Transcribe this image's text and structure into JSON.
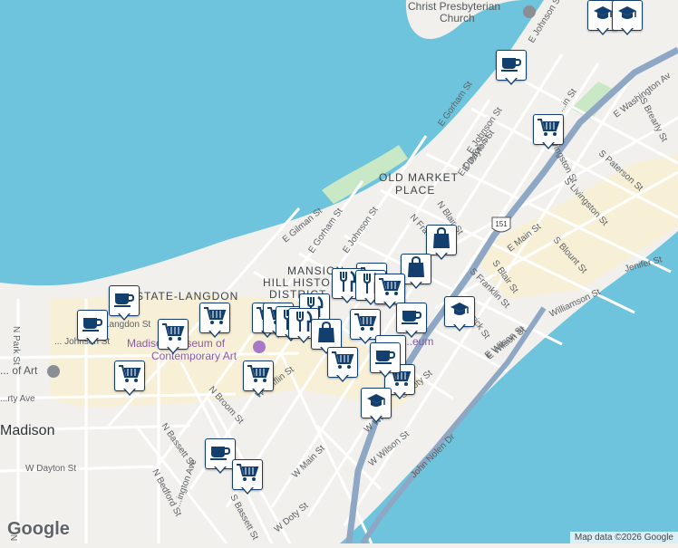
{
  "map": {
    "colors": {
      "water": "#6ec4dc",
      "land": "#f1f0ed",
      "park": "#c9e8c5",
      "highway": "#8ea7c4",
      "major_road": "#ffffff",
      "minor_road": "#ffffff",
      "highlight_area": "#f7eed3",
      "marker_border": "#123f6d",
      "marker_icon": "#123f6d"
    },
    "labels": {
      "church": "Christ Presbyterian\nChurch",
      "old_market": "OLD MARKET\nPLACE",
      "mansion_hill": "MANSION\nHILL HISTO\nDISTRICT",
      "state_langdon": "STATE-LANGDON",
      "museum": "Madison Museum of\nContemporary Art",
      "history_museum": "...eum",
      "art": "... of Art",
      "madison": "Madison",
      "highway_shield": "151"
    },
    "streets": [
      "E Johnson St",
      "E Gorham St",
      "E Johnson St",
      "N Livingston St",
      "E Dayton St",
      "E Washington Av",
      "S Brearly St",
      "S Paterson St",
      "S Livingston St",
      "E Main St",
      "S Blount St",
      "Jenifer St",
      "E Gilman St",
      "E Gorham St",
      "N Blair St",
      "S Blair St",
      "S Franklin St",
      "Williamson St",
      "E Wilson St",
      "E Johnson St",
      "N Fra",
      "Langdon St",
      "N Park St",
      "N Park St",
      "... Johnson St",
      "N Broom St",
      "W Mifflin St",
      "N Bassett St",
      "W Dayton St",
      "N Bedford St",
      "W Main St",
      "S Bassett St",
      "...ington Ave",
      "W Doty St",
      "W Wilson St",
      "John Nolen Dr",
      "W Wi...",
      "S Doty St",
      "...rty Ave",
      "E Dayton St",
      "...in St",
      "...rick St",
      "E Wilson St"
    ],
    "markers": [
      {
        "icon": "school-icon"
      },
      {
        "icon": "school-icon"
      },
      {
        "icon": "coffee-icon"
      },
      {
        "icon": "shopping-cart-icon"
      },
      {
        "icon": "shopping-bag-icon"
      },
      {
        "icon": "shopping-bag-icon"
      },
      {
        "icon": "shopping-cart-icon"
      },
      {
        "icon": "shopping-cart-icon"
      },
      {
        "icon": "restaurant-icon"
      },
      {
        "icon": "restaurant-icon"
      },
      {
        "icon": "shopping-cart-icon"
      },
      {
        "icon": "coffee-icon"
      },
      {
        "icon": "school-icon"
      },
      {
        "icon": "coffee-icon"
      },
      {
        "icon": "coffee-icon"
      },
      {
        "icon": "shopping-cart-icon"
      },
      {
        "icon": "shopping-cart-icon"
      },
      {
        "icon": "shopping-cart-icon"
      },
      {
        "icon": "shopping-cart-icon"
      },
      {
        "icon": "restaurant-icon"
      },
      {
        "icon": "restaurant-icon"
      },
      {
        "icon": "restaurant-icon"
      },
      {
        "icon": "shopping-bag-icon"
      },
      {
        "icon": "shopping-cart-icon"
      },
      {
        "icon": "shopping-cart-icon"
      },
      {
        "icon": "coffee-icon"
      },
      {
        "icon": "shopping-cart-icon"
      },
      {
        "icon": "coffee-icon"
      },
      {
        "icon": "shopping-cart-icon"
      },
      {
        "icon": "school-icon"
      },
      {
        "icon": "shopping-cart-icon"
      },
      {
        "icon": "coffee-icon"
      },
      {
        "icon": "shopping-cart-icon"
      }
    ],
    "attribution": "Map data ©2026 Google",
    "logo": "Google"
  }
}
